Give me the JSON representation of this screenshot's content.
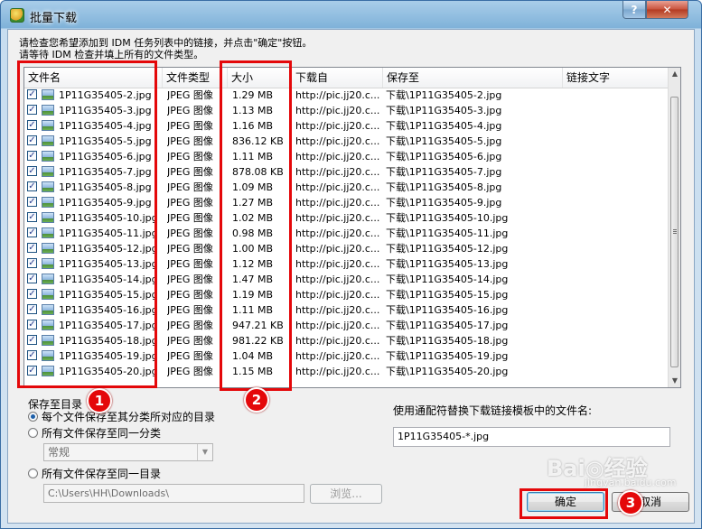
{
  "window": {
    "title": "批量下载",
    "help_label": "?",
    "close_label": "✕"
  },
  "instructions": {
    "line1": "请检查您希望添加到 IDM 任务列表中的链接，并点击\"确定\"按钮。",
    "line2": "请等待 IDM 检查并填上所有的文件类型。"
  },
  "list": {
    "columns": [
      "文件名",
      "文件类型",
      "大小",
      "下载自",
      "保存至",
      "链接文字"
    ],
    "rows": [
      {
        "name": "1P11G35405-2.jpg",
        "type": "JPEG 图像",
        "size": "1.29  MB",
        "from": "http://pic.jj20.c...",
        "save": "下载\\1P11G35405-2.jpg",
        "link": ""
      },
      {
        "name": "1P11G35405-3.jpg",
        "type": "JPEG 图像",
        "size": "1.13  MB",
        "from": "http://pic.jj20.c...",
        "save": "下载\\1P11G35405-3.jpg",
        "link": ""
      },
      {
        "name": "1P11G35405-4.jpg",
        "type": "JPEG 图像",
        "size": "1.16  MB",
        "from": "http://pic.jj20.c...",
        "save": "下载\\1P11G35405-4.jpg",
        "link": ""
      },
      {
        "name": "1P11G35405-5.jpg",
        "type": "JPEG 图像",
        "size": "836.12  KB",
        "from": "http://pic.jj20.c...",
        "save": "下载\\1P11G35405-5.jpg",
        "link": ""
      },
      {
        "name": "1P11G35405-6.jpg",
        "type": "JPEG 图像",
        "size": "1.11  MB",
        "from": "http://pic.jj20.c...",
        "save": "下载\\1P11G35405-6.jpg",
        "link": ""
      },
      {
        "name": "1P11G35405-7.jpg",
        "type": "JPEG 图像",
        "size": "878.08  KB",
        "from": "http://pic.jj20.c...",
        "save": "下载\\1P11G35405-7.jpg",
        "link": ""
      },
      {
        "name": "1P11G35405-8.jpg",
        "type": "JPEG 图像",
        "size": "1.09  MB",
        "from": "http://pic.jj20.c...",
        "save": "下载\\1P11G35405-8.jpg",
        "link": ""
      },
      {
        "name": "1P11G35405-9.jpg",
        "type": "JPEG 图像",
        "size": "1.27  MB",
        "from": "http://pic.jj20.c...",
        "save": "下载\\1P11G35405-9.jpg",
        "link": ""
      },
      {
        "name": "1P11G35405-10.jpg",
        "type": "JPEG 图像",
        "size": "1.02  MB",
        "from": "http://pic.jj20.c...",
        "save": "下载\\1P11G35405-10.jpg",
        "link": ""
      },
      {
        "name": "1P11G35405-11.jpg",
        "type": "JPEG 图像",
        "size": "0.98  MB",
        "from": "http://pic.jj20.c...",
        "save": "下载\\1P11G35405-11.jpg",
        "link": ""
      },
      {
        "name": "1P11G35405-12.jpg",
        "type": "JPEG 图像",
        "size": "1.00  MB",
        "from": "http://pic.jj20.c...",
        "save": "下载\\1P11G35405-12.jpg",
        "link": ""
      },
      {
        "name": "1P11G35405-13.jpg",
        "type": "JPEG 图像",
        "size": "1.12  MB",
        "from": "http://pic.jj20.c...",
        "save": "下载\\1P11G35405-13.jpg",
        "link": ""
      },
      {
        "name": "1P11G35405-14.jpg",
        "type": "JPEG 图像",
        "size": "1.47  MB",
        "from": "http://pic.jj20.c...",
        "save": "下载\\1P11G35405-14.jpg",
        "link": ""
      },
      {
        "name": "1P11G35405-15.jpg",
        "type": "JPEG 图像",
        "size": "1.19  MB",
        "from": "http://pic.jj20.c...",
        "save": "下载\\1P11G35405-15.jpg",
        "link": ""
      },
      {
        "name": "1P11G35405-16.jpg",
        "type": "JPEG 图像",
        "size": "1.11  MB",
        "from": "http://pic.jj20.c...",
        "save": "下载\\1P11G35405-16.jpg",
        "link": ""
      },
      {
        "name": "1P11G35405-17.jpg",
        "type": "JPEG 图像",
        "size": "947.21  KB",
        "from": "http://pic.jj20.c...",
        "save": "下载\\1P11G35405-17.jpg",
        "link": ""
      },
      {
        "name": "1P11G35405-18.jpg",
        "type": "JPEG 图像",
        "size": "981.22  KB",
        "from": "http://pic.jj20.c...",
        "save": "下载\\1P11G35405-18.jpg",
        "link": ""
      },
      {
        "name": "1P11G35405-19.jpg",
        "type": "JPEG 图像",
        "size": "1.04  MB",
        "from": "http://pic.jj20.c...",
        "save": "下载\\1P11G35405-19.jpg",
        "link": ""
      },
      {
        "name": "1P11G35405-20.jpg",
        "type": "JPEG 图像",
        "size": "1.15  MB",
        "from": "http://pic.jj20.c...",
        "save": "下载\\1P11G35405-20.jpg",
        "link": ""
      }
    ]
  },
  "save_group": {
    "title": "保存至目录",
    "option1": "每个文件保存至其分类所对应的目录",
    "option2": "所有文件保存至同一分类",
    "category_value": "常规",
    "option3": "所有文件保存至同一目录",
    "path_value": "C:\\Users\\HH\\Downloads\\",
    "browse_label": "浏览..."
  },
  "template": {
    "label": "使用通配符替换下载链接模板中的文件名:",
    "value": "1P11G35405-*.jpg"
  },
  "buttons": {
    "ok_label": "确定",
    "cancel_label": "取消"
  },
  "annotations": {
    "badge1": "1",
    "badge2": "2",
    "badge3": "3"
  },
  "watermark": {
    "main": "Bai◎经验",
    "sub": "jingyan.baidu.com"
  },
  "colors": {
    "annotation_red": "#e4080a",
    "selection_blue": "#1d5fa8"
  }
}
